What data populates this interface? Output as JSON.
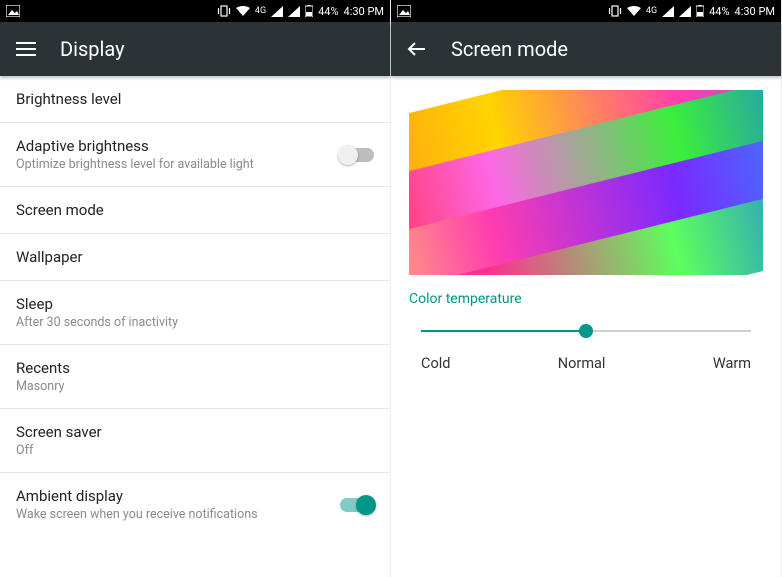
{
  "status": {
    "network_label": "4G",
    "battery_pct": "44%",
    "time": "4:30 PM"
  },
  "left": {
    "title": "Display",
    "items": {
      "brightness": {
        "label": "Brightness level"
      },
      "adaptive": {
        "label": "Adaptive brightness",
        "sub": "Optimize brightness level for available light",
        "on": false
      },
      "screen_mode": {
        "label": "Screen mode"
      },
      "wallpaper": {
        "label": "Wallpaper"
      },
      "sleep": {
        "label": "Sleep",
        "sub": "After 30 seconds of inactivity"
      },
      "recents": {
        "label": "Recents",
        "sub": "Masonry"
      },
      "screensaver": {
        "label": "Screen saver",
        "sub": "Off"
      },
      "ambient": {
        "label": "Ambient display",
        "sub": "Wake screen when you receive notifications",
        "on": true
      }
    }
  },
  "right": {
    "title": "Screen mode",
    "section_label": "Color temperature",
    "slider": {
      "pct": 50,
      "min_label": "Cold",
      "mid_label": "Normal",
      "max_label": "Warm"
    }
  },
  "colors": {
    "accent": "#009688",
    "appbar": "#2c3337"
  }
}
